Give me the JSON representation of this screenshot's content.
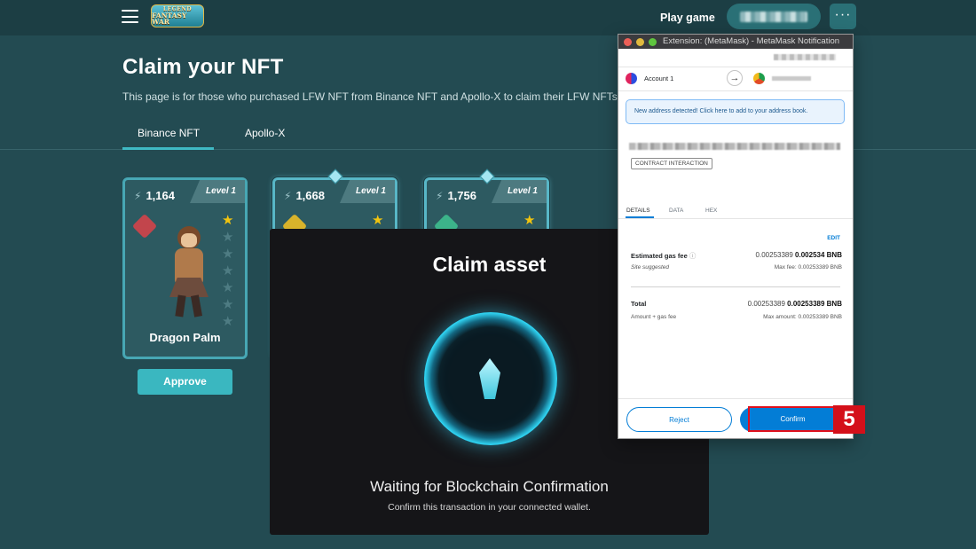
{
  "topbar": {
    "logo_line1": "LEGEND",
    "logo_line2": "FANTASY WAR",
    "play_game": "Play game",
    "more_label": "···"
  },
  "page": {
    "title": "Claim your NFT",
    "description": "This page is for those who purchased LFW NFT from Binance NFT and Apollo-X to claim their LFW NFTs.",
    "tabs": [
      {
        "label": "Binance NFT",
        "active": true
      },
      {
        "label": "Apollo-X",
        "active": false
      }
    ]
  },
  "cards": [
    {
      "power": "1,164",
      "level": "Level 1",
      "name": "Dragon Palm",
      "stars_total": 7,
      "stars_on": 1,
      "element_color": "#c2454c"
    },
    {
      "power": "1,668",
      "level": "Level 1",
      "stars_on": 1,
      "element_color": "#d8b32b"
    },
    {
      "power": "1,756",
      "level": "Level 1",
      "stars_on": 1,
      "element_color": "#3cb38a"
    }
  ],
  "approve_label": "Approve",
  "claim_modal": {
    "title": "Claim asset",
    "status": "Waiting for Blockchain Confirmation",
    "hint": "Confirm this transaction in your connected wallet."
  },
  "metamask": {
    "window_title": "Extension: (MetaMask) - MetaMask Notification",
    "account": "Account 1",
    "notice": "New address detected! Click here to add to your address book.",
    "contract_tag": "CONTRACT INTERACTION",
    "tabs": [
      "DETAILS",
      "DATA",
      "HEX"
    ],
    "edit": "EDIT",
    "gas_fee_label": "Estimated gas fee",
    "gas_fee_sub": "Site suggested",
    "gas_fee_value_light": "0.00253389",
    "gas_fee_value_bold": "0.002534",
    "gas_fee_unit": "BNB",
    "max_fee": "Max fee: 0.00253389 BNB",
    "total_label": "Total",
    "total_sub": "Amount + gas fee",
    "total_value_light": "0.00253389",
    "total_value_bold": "0.00253389",
    "total_unit": "BNB",
    "max_amount": "Max amount: 0.00253389 BNB",
    "reject": "Reject",
    "confirm": "Confirm"
  },
  "step_badge": "5",
  "colors": {
    "background": "#234b52",
    "accent": "#3ab7c0",
    "metamask_blue": "#037dd6",
    "highlight_red": "#e0101c",
    "star_gold": "#f1c40f"
  }
}
